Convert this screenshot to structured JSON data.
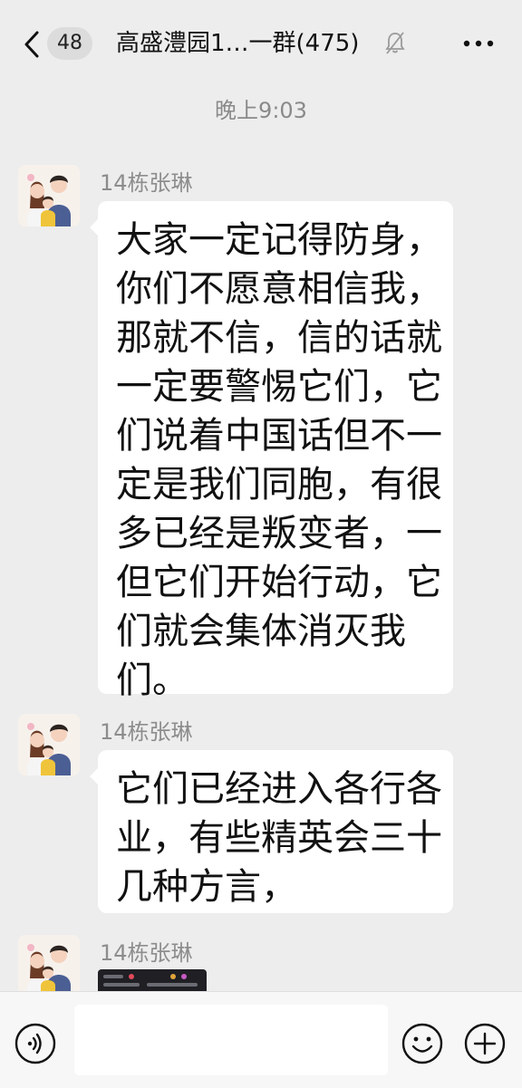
{
  "header": {
    "unread_count": "48",
    "title": "高盛澧园1…一群(475)"
  },
  "timestamp": "晚上9:03",
  "messages": [
    {
      "sender": "14栋张琳",
      "text": "大家一定记得防身，你们不愿意相信我，那就不信，信的话就一定要警惕它们，它们说着中国话但不一定是我们同胞，有很多已经是叛变者，一但它们开始行动，它们就会集体消灭我们。"
    },
    {
      "sender": "14栋张琳",
      "text": "它们已经进入各行各业，有些精英会三十几种方言，"
    },
    {
      "sender": "14栋张琳"
    }
  ],
  "input": {
    "value": ""
  },
  "colors": {
    "background": "#ededed",
    "bubble": "#ffffff",
    "meta_text": "#8d8d8d"
  },
  "icons": [
    "back-icon",
    "mute-icon",
    "more-icon",
    "voice-icon",
    "emoji-icon",
    "plus-icon"
  ]
}
